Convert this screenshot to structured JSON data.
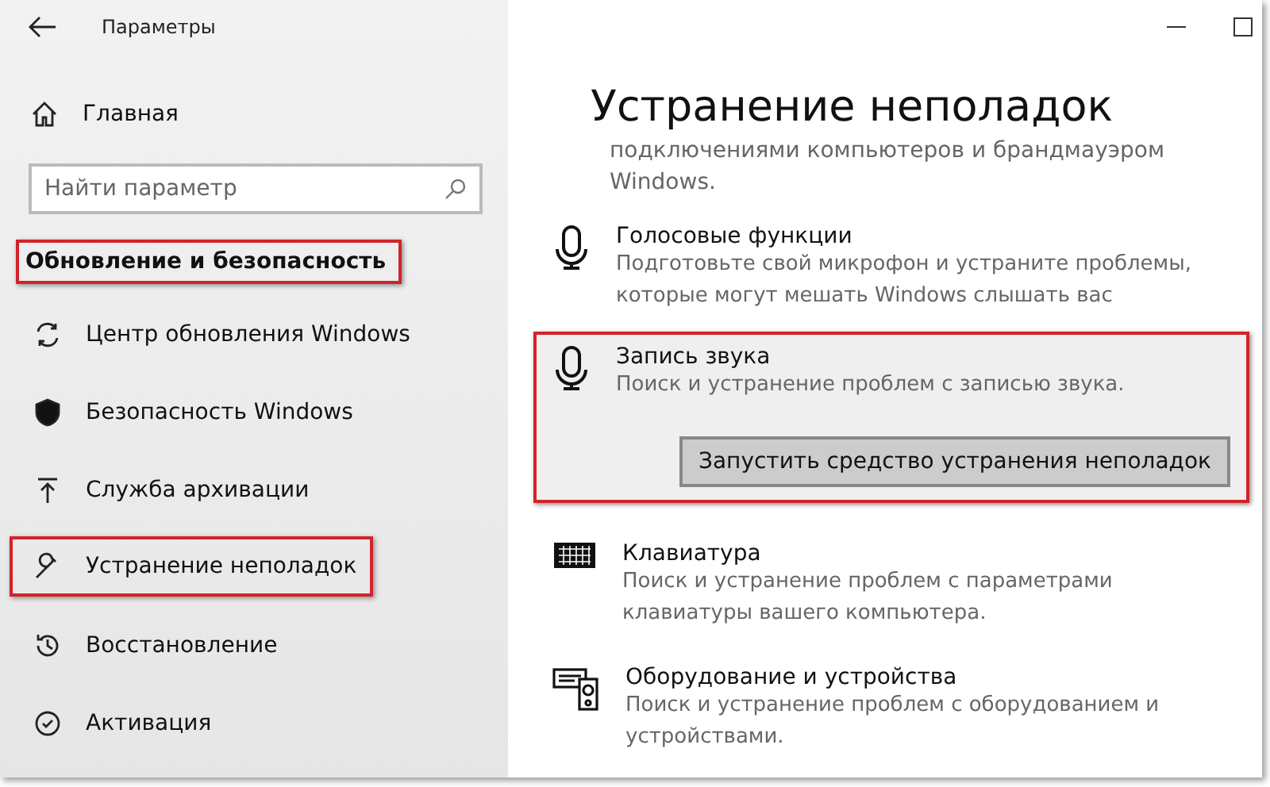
{
  "window": {
    "title": "Параметры"
  },
  "sidebar": {
    "home": "Главная",
    "search": {
      "placeholder": "Найти параметр"
    },
    "section": {
      "label": "Обновление и безопасность",
      "highlighted": true
    },
    "items": [
      {
        "label": "Центр обновления Windows",
        "highlighted": false
      },
      {
        "label": "Безопасность Windows",
        "highlighted": false
      },
      {
        "label": "Служба архивации",
        "highlighted": false
      },
      {
        "label": "Устранение неполадок",
        "highlighted": true
      },
      {
        "label": "Восстановление",
        "highlighted": false
      },
      {
        "label": "Активация",
        "highlighted": false
      }
    ]
  },
  "main": {
    "title": "Устранение неполадок",
    "intro": "подключениями компьютеров и брандмауэром Windows.",
    "troubleshooters": [
      {
        "title": "Голосовые функции",
        "description": "Подготовьте свой микрофон и устраните проблемы, которые могут мешать Windows слышать вас",
        "expanded": false,
        "highlighted": false
      },
      {
        "title": "Запись звука",
        "description": "Поиск и устранение проблем с записью звука.",
        "expanded": true,
        "highlighted": true,
        "button": "Запустить средство устранения неполадок"
      },
      {
        "title": "Клавиатура",
        "description": "Поиск и устранение проблем с параметрами клавиатуры вашего компьютера.",
        "expanded": false,
        "highlighted": false
      },
      {
        "title": "Оборудование и устройства",
        "description": "Поиск и устранение проблем с оборудованием и устройствами.",
        "expanded": false,
        "highlighted": false
      }
    ]
  }
}
